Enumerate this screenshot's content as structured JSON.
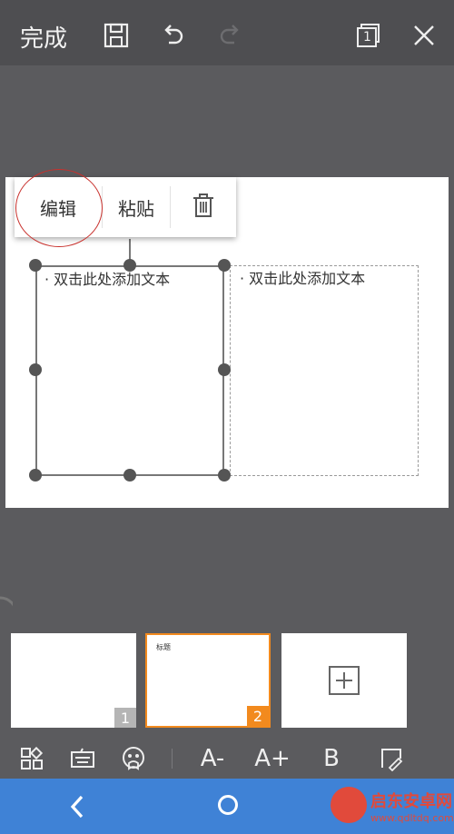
{
  "toolbar": {
    "done_label": "完成",
    "icons": [
      "save-icon",
      "undo-icon",
      "redo-icon",
      "page-view-icon",
      "close-icon"
    ],
    "page_view_number": "1"
  },
  "slide": {
    "placeholders": [
      {
        "text": "· 双击此处添加文本"
      },
      {
        "text": "· 双击此处添加文本"
      }
    ]
  },
  "context_menu": {
    "edit_label": "编辑",
    "paste_label": "粘贴",
    "delete_icon": "trash-icon"
  },
  "thumbnails": [
    {
      "number": "1",
      "selected": false
    },
    {
      "number": "2",
      "selected": true,
      "mini_text": "标题"
    }
  ],
  "add_slide_icon": "add-slide-icon",
  "format_bar": {
    "icons": [
      "layout-grid-icon",
      "keyboard-icon",
      "emoji-icon",
      "shape-icon"
    ],
    "font_smaller": "A-",
    "font_larger": "A+",
    "bold": "B"
  },
  "navbar": {
    "back_icon": "chevron-left-icon",
    "home_icon": "home-circle-icon"
  },
  "watermark": {
    "title": "启东安卓网",
    "url": "www.qdltdq.com"
  },
  "colors": {
    "accent_orange": "#f28a1e",
    "nav_blue": "#3f82d6",
    "annotation_red": "#c8302c"
  }
}
